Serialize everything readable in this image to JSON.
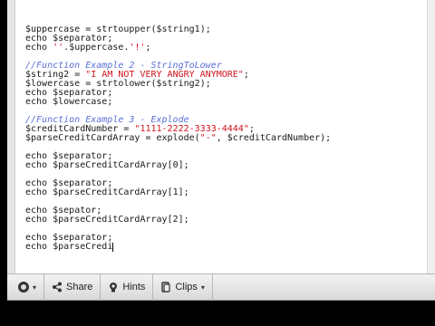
{
  "code": {
    "lines": [
      {
        "kind": "code",
        "parts": [
          [
            "var",
            "$uppercase"
          ],
          [
            "kw",
            " = strtoupper("
          ],
          [
            "var",
            "$string1"
          ],
          [
            "kw",
            ");"
          ]
        ]
      },
      {
        "kind": "code",
        "parts": [
          [
            "kw",
            "echo "
          ],
          [
            "var",
            "$separator"
          ],
          [
            "kw",
            ";"
          ]
        ]
      },
      {
        "kind": "code",
        "parts": [
          [
            "kw",
            "echo "
          ],
          [
            "str",
            "''"
          ],
          [
            "kw",
            "."
          ],
          [
            "var",
            "$uppercase"
          ],
          [
            "kw",
            "."
          ],
          [
            "str",
            "'!'"
          ],
          [
            "kw",
            ";"
          ]
        ]
      },
      {
        "kind": "blank"
      },
      {
        "kind": "code",
        "parts": [
          [
            "comment",
            "//Function Example 2 - StringToLower"
          ]
        ]
      },
      {
        "kind": "code",
        "parts": [
          [
            "var",
            "$string2"
          ],
          [
            "kw",
            " = "
          ],
          [
            "str",
            "\"I AM NOT VERY ANGRY ANYMORE\""
          ],
          [
            "kw",
            ";"
          ]
        ]
      },
      {
        "kind": "code",
        "parts": [
          [
            "var",
            "$lowercase"
          ],
          [
            "kw",
            " = strtolower("
          ],
          [
            "var",
            "$string2"
          ],
          [
            "kw",
            ");"
          ]
        ]
      },
      {
        "kind": "code",
        "parts": [
          [
            "kw",
            "echo "
          ],
          [
            "var",
            "$separator"
          ],
          [
            "kw",
            ";"
          ]
        ]
      },
      {
        "kind": "code",
        "parts": [
          [
            "kw",
            "echo "
          ],
          [
            "var",
            "$lowercase"
          ],
          [
            "kw",
            ";"
          ]
        ]
      },
      {
        "kind": "blank"
      },
      {
        "kind": "code",
        "parts": [
          [
            "comment",
            "//Function Example 3 - Explode"
          ]
        ]
      },
      {
        "kind": "code",
        "parts": [
          [
            "var",
            "$creditCardNumber"
          ],
          [
            "kw",
            " = "
          ],
          [
            "str",
            "\"1111-2222-3333-4444\""
          ],
          [
            "kw",
            ";"
          ]
        ]
      },
      {
        "kind": "code",
        "parts": [
          [
            "var",
            "$parseCreditCardArray"
          ],
          [
            "kw",
            " = explode("
          ],
          [
            "str",
            "\"-\""
          ],
          [
            "kw",
            ", "
          ],
          [
            "var",
            "$creditCardNumber"
          ],
          [
            "kw",
            ");"
          ]
        ]
      },
      {
        "kind": "blank"
      },
      {
        "kind": "code",
        "parts": [
          [
            "kw",
            "echo "
          ],
          [
            "var",
            "$separator"
          ],
          [
            "kw",
            ";"
          ]
        ]
      },
      {
        "kind": "code",
        "parts": [
          [
            "kw",
            "echo "
          ],
          [
            "var",
            "$parseCreditCardArray"
          ],
          [
            "kw",
            "[0];"
          ]
        ]
      },
      {
        "kind": "blank"
      },
      {
        "kind": "code",
        "parts": [
          [
            "kw",
            "echo "
          ],
          [
            "var",
            "$separator"
          ],
          [
            "kw",
            ";"
          ]
        ]
      },
      {
        "kind": "code",
        "parts": [
          [
            "kw",
            "echo "
          ],
          [
            "var",
            "$parseCreditCardArray"
          ],
          [
            "kw",
            "[1];"
          ]
        ]
      },
      {
        "kind": "blank"
      },
      {
        "kind": "code",
        "parts": [
          [
            "kw",
            "echo "
          ],
          [
            "var",
            "$sepator"
          ],
          [
            "kw",
            ";"
          ]
        ]
      },
      {
        "kind": "code",
        "parts": [
          [
            "kw",
            "echo "
          ],
          [
            "var",
            "$parseCreditCardArray"
          ],
          [
            "kw",
            "[2];"
          ]
        ]
      },
      {
        "kind": "blank"
      },
      {
        "kind": "code",
        "parts": [
          [
            "kw",
            "echo "
          ],
          [
            "var",
            "$separator"
          ],
          [
            "kw",
            ";"
          ]
        ]
      },
      {
        "kind": "code",
        "parts": [
          [
            "kw",
            "echo "
          ],
          [
            "var",
            "$parseCredi"
          ]
        ],
        "cursor": true
      }
    ]
  },
  "toolbar": {
    "settings_icon": "gear-icon",
    "share_label": "Share",
    "hints_label": "Hints",
    "clips_label": "Clips"
  },
  "colors": {
    "comment": "#5b6fd6",
    "string": "#d0141d",
    "text": "#1a1a1a"
  }
}
